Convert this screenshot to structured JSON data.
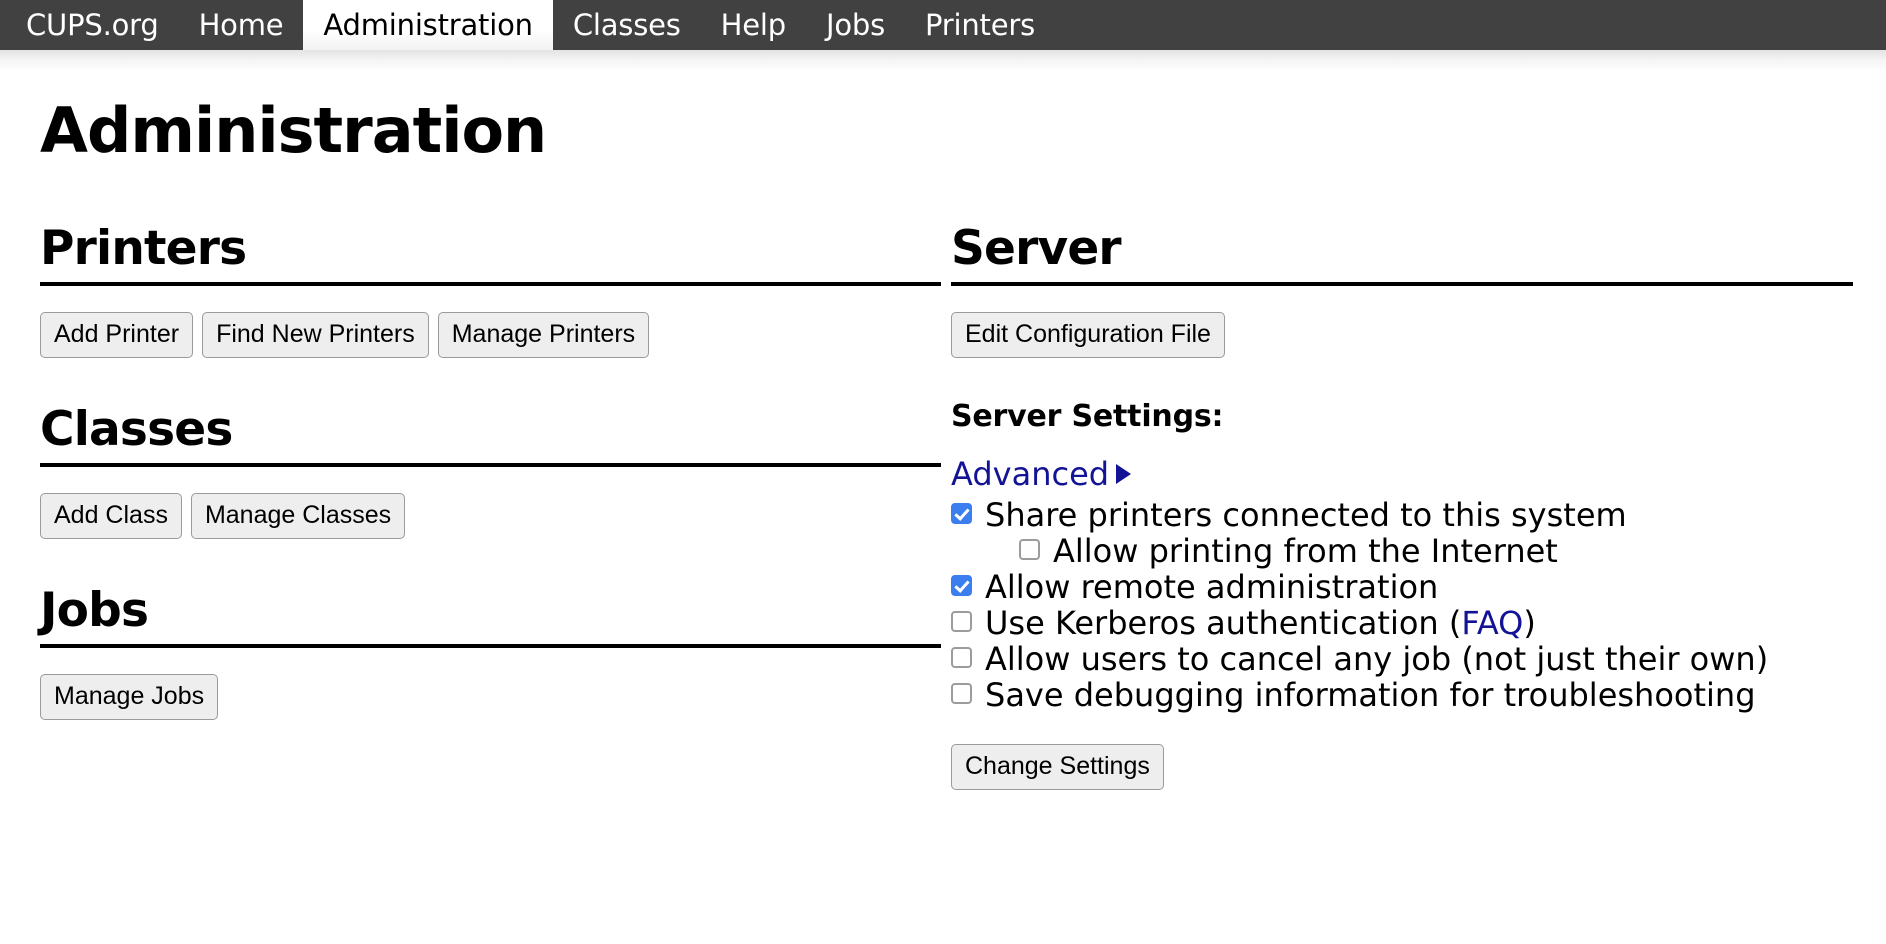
{
  "nav": {
    "items": [
      {
        "label": "CUPS.org",
        "name": "nav-cups-org",
        "active": false
      },
      {
        "label": "Home",
        "name": "nav-home",
        "active": false
      },
      {
        "label": "Administration",
        "name": "nav-administration",
        "active": true
      },
      {
        "label": "Classes",
        "name": "nav-classes",
        "active": false
      },
      {
        "label": "Help",
        "name": "nav-help",
        "active": false
      },
      {
        "label": "Jobs",
        "name": "nav-jobs",
        "active": false
      },
      {
        "label": "Printers",
        "name": "nav-printers",
        "active": false
      }
    ]
  },
  "page": {
    "title": "Administration"
  },
  "printers": {
    "heading": "Printers",
    "buttons": [
      {
        "label": "Add Printer",
        "name": "add-printer-button"
      },
      {
        "label": "Find New Printers",
        "name": "find-new-printers-button"
      },
      {
        "label": "Manage Printers",
        "name": "manage-printers-button"
      }
    ]
  },
  "classes": {
    "heading": "Classes",
    "buttons": [
      {
        "label": "Add Class",
        "name": "add-class-button"
      },
      {
        "label": "Manage Classes",
        "name": "manage-classes-button"
      }
    ]
  },
  "jobs": {
    "heading": "Jobs",
    "buttons": [
      {
        "label": "Manage Jobs",
        "name": "manage-jobs-button"
      }
    ]
  },
  "server": {
    "heading": "Server",
    "edit_config_label": "Edit Configuration File",
    "settings_label": "Server Settings:",
    "advanced_label": "Advanced",
    "advanced_icon": "triangle-right-icon",
    "change_settings_label": "Change Settings",
    "settings": [
      {
        "label": "Share printers connected to this system",
        "checked": true,
        "indent": false,
        "name": "checkbox-share-printers"
      },
      {
        "label": "Allow printing from the Internet",
        "checked": false,
        "indent": true,
        "name": "checkbox-allow-internet-printing"
      },
      {
        "label": "Allow remote administration",
        "checked": true,
        "indent": false,
        "name": "checkbox-allow-remote-administration"
      },
      {
        "label_pre": "Use Kerberos authentication (",
        "link": "FAQ",
        "label_post": ")",
        "checked": false,
        "indent": false,
        "name": "checkbox-use-kerberos"
      },
      {
        "label": "Allow users to cancel any job (not just their own)",
        "checked": false,
        "indent": false,
        "name": "checkbox-allow-cancel-any-job"
      },
      {
        "label": "Save debugging information for troubleshooting",
        "checked": false,
        "indent": false,
        "name": "checkbox-save-debugging-info"
      }
    ]
  },
  "colors": {
    "navbar_bg": "#414141",
    "checkbox_checked": "#3b7ef0",
    "link": "#131396",
    "button_bg": "#eeeeee"
  }
}
